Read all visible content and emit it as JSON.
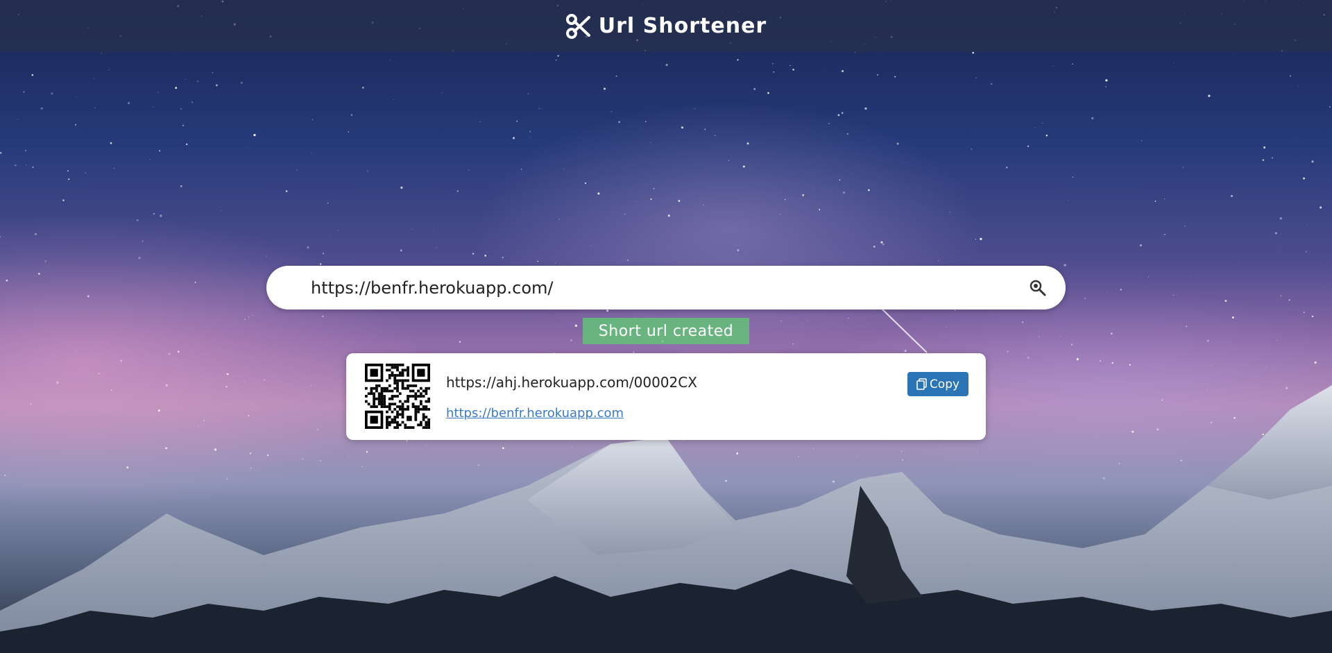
{
  "header": {
    "title": "Url Shortener",
    "logo_icon": "scissors-icon"
  },
  "search": {
    "value": "https://benfr.herokuapp.com/",
    "button_icon": "search-icon"
  },
  "status": {
    "message": "Short url created",
    "color": "#62c476"
  },
  "result": {
    "qr_icon": "qr-code-icon",
    "short_url": "https://ahj.herokuapp.com/00002CX",
    "original_url": "https://benfr.herokuapp.com",
    "copy_label": "Copy",
    "copy_icon": "copy-icon"
  },
  "colors": {
    "accent": "#2b74b6",
    "link": "#3a7ac4",
    "success": "#62c476"
  }
}
